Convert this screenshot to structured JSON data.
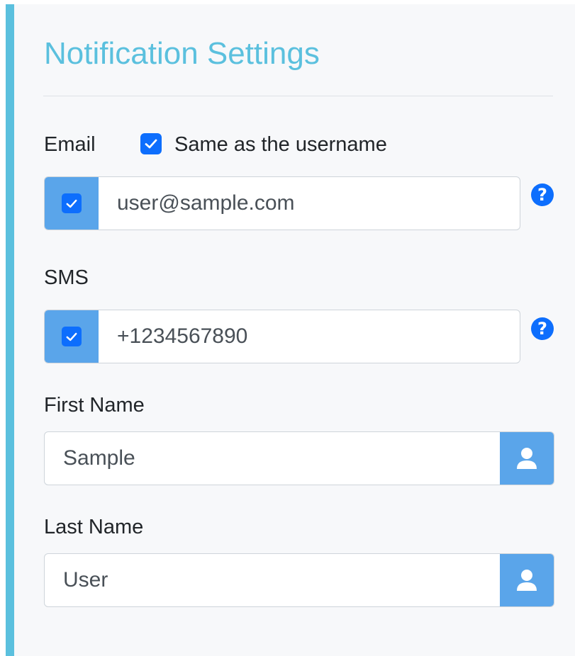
{
  "panel": {
    "title": "Notification Settings",
    "accent_color": "#5bc0de"
  },
  "email": {
    "label": "Email",
    "same_as_username_label": "Same as the username",
    "same_as_username_checked": true,
    "enabled_checked": true,
    "value": "user@sample.com",
    "help_icon": "question-circle-icon"
  },
  "sms": {
    "label": "SMS",
    "enabled_checked": true,
    "value": "+1234567890",
    "help_icon": "question-circle-icon"
  },
  "first_name": {
    "label": "First Name",
    "value": "Sample",
    "icon": "user-icon"
  },
  "last_name": {
    "label": "Last Name",
    "value": "User",
    "icon": "user-icon"
  },
  "colors": {
    "checkbox": "#0d6efd",
    "addon": "#5aa5ea"
  }
}
